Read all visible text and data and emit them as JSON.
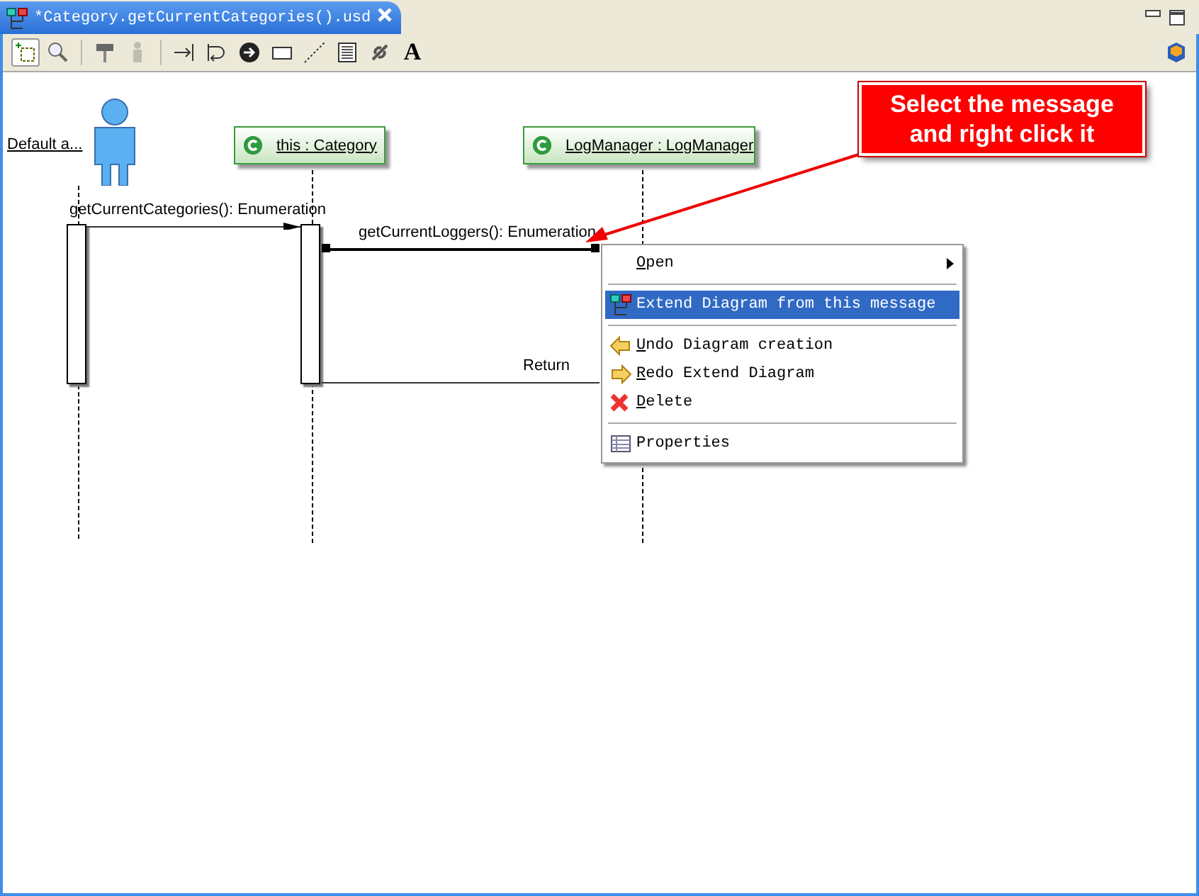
{
  "editor_tab": {
    "title": "*Category.getCurrentCategories().usd",
    "selected": true
  },
  "toolbar": [
    {
      "kind": "select",
      "selected": true
    },
    {
      "kind": "zoom",
      "selected": false
    },
    {
      "kind": "stamp",
      "selected": false
    },
    {
      "kind": "figure",
      "selected": false,
      "disabled": true
    },
    {
      "kind": "message",
      "selected": false
    },
    {
      "kind": "self",
      "selected": false
    },
    {
      "kind": "circle",
      "selected": false
    },
    {
      "kind": "rect",
      "selected": false
    },
    {
      "kind": "dots",
      "selected": false
    },
    {
      "kind": "note",
      "selected": false
    },
    {
      "kind": "link",
      "selected": false
    },
    {
      "kind": "text",
      "selected": false,
      "glyph": "A"
    }
  ],
  "diagram": {
    "actor": {
      "label": "Default a..."
    },
    "lifelines": [
      {
        "name": "this : Category"
      },
      {
        "name": "LogManager : LogManager"
      }
    ],
    "messages": [
      {
        "kind": "call",
        "label": "getCurrentCategories(): Enumeration",
        "selected": false
      },
      {
        "kind": "call",
        "label": "getCurrentLoggers(): Enumeration",
        "selected": true
      },
      {
        "kind": "return",
        "label": "Return",
        "selected": false
      }
    ]
  },
  "context_menu": [
    {
      "kind": "open",
      "label": "Open",
      "underlined": true,
      "submenu": true,
      "selected": false
    },
    {
      "kind": "separator"
    },
    {
      "kind": "extend",
      "label": "Extend Diagram from this message",
      "underlined": false,
      "selected": true
    },
    {
      "kind": "separator"
    },
    {
      "kind": "undo",
      "label": "Undo Diagram creation",
      "underlined": true,
      "selected": false
    },
    {
      "kind": "redo",
      "label": "Redo Extend Diagram",
      "underlined": true,
      "selected": false
    },
    {
      "kind": "delete",
      "label": "Delete",
      "underlined": true,
      "selected": false
    },
    {
      "kind": "separator"
    },
    {
      "kind": "properties",
      "label": "Properties",
      "underlined": false,
      "selected": false
    }
  ],
  "callout": {
    "lines": [
      "Select the message",
      "and right click it"
    ]
  }
}
